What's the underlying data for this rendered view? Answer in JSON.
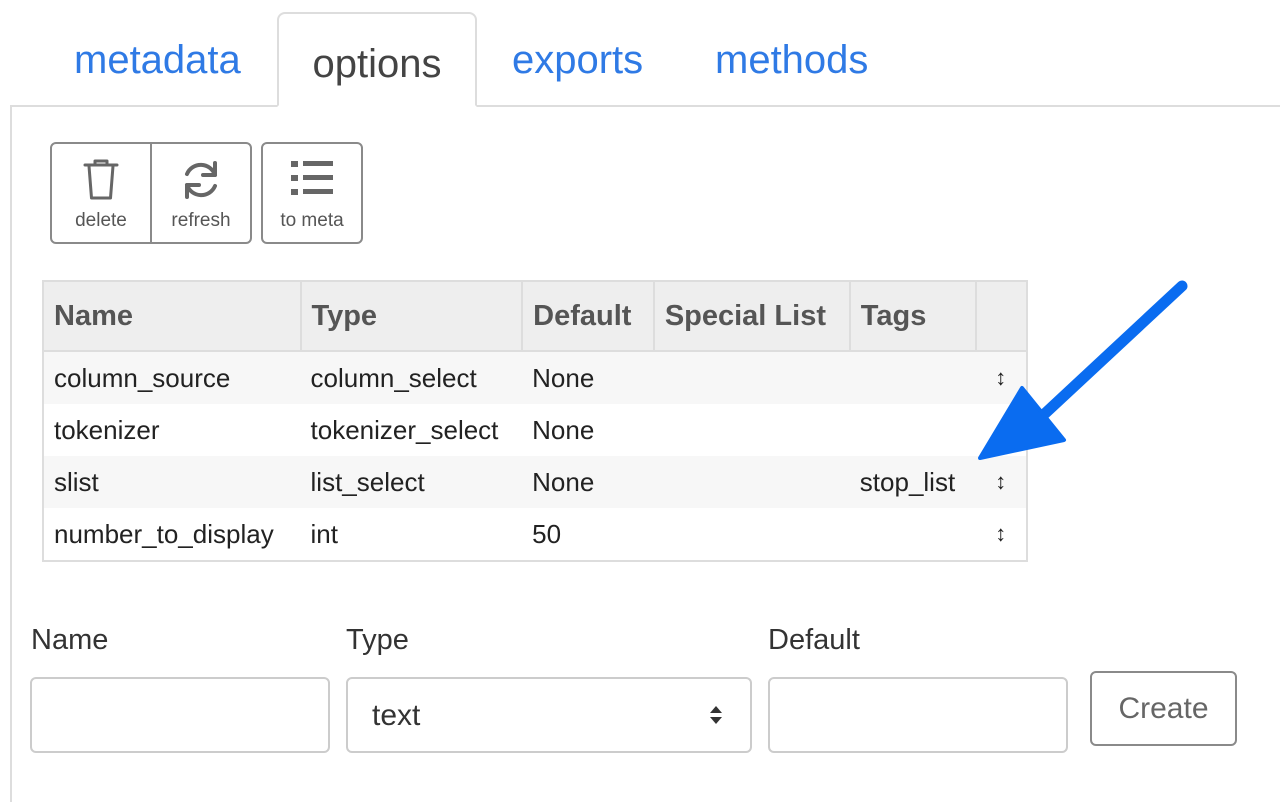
{
  "tabs": [
    {
      "label": "metadata",
      "active": false
    },
    {
      "label": "options",
      "active": true
    },
    {
      "label": "exports",
      "active": false
    },
    {
      "label": "methods",
      "active": false
    }
  ],
  "toolbar": {
    "delete_label": "delete",
    "refresh_label": "refresh",
    "to_meta_label": "to meta"
  },
  "table": {
    "headers": [
      "Name",
      "Type",
      "Default",
      "Special List",
      "Tags"
    ],
    "rows": [
      {
        "name": "column_source",
        "type": "column_select",
        "default": "None",
        "special_list": "",
        "tags": ""
      },
      {
        "name": "tokenizer",
        "type": "tokenizer_select",
        "default": "None",
        "special_list": "",
        "tags": ""
      },
      {
        "name": "slist",
        "type": "list_select",
        "default": "None",
        "special_list": "",
        "tags": "stop_list"
      },
      {
        "name": "number_to_display",
        "type": "int",
        "default": "50",
        "special_list": "",
        "tags": ""
      }
    ]
  },
  "form": {
    "name_label": "Name",
    "type_label": "Type",
    "default_label": "Default",
    "name_value": "",
    "type_value": "text",
    "default_value": "",
    "create_label": "Create"
  },
  "colors": {
    "link": "#2f7ae5",
    "arrow": "#0a6cf0",
    "border": "#dddddd",
    "header_bg": "#eeeeee"
  },
  "icons": {
    "delete": "trash-icon",
    "refresh": "refresh-icon",
    "to_meta": "list-icon",
    "sort": "sort-handle-icon",
    "select_caret": "chevron-updown-icon"
  }
}
